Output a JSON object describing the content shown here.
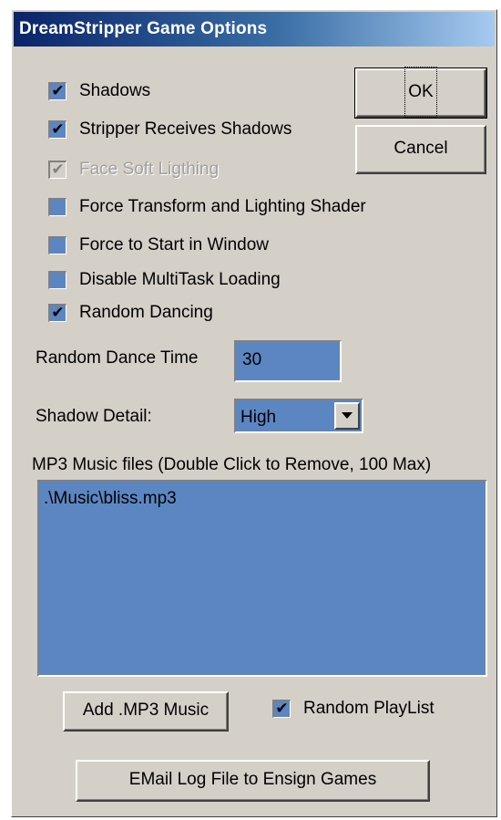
{
  "window": {
    "title": "DreamStripper Game Options"
  },
  "buttons": {
    "ok": "OK",
    "cancel": "Cancel",
    "add_music": "Add .MP3 Music",
    "email_log": "EMail Log File to Ensign Games"
  },
  "checkboxes": [
    {
      "label": "Shadows",
      "checked": true,
      "enabled": true
    },
    {
      "label": "Stripper Receives Shadows",
      "checked": true,
      "enabled": true
    },
    {
      "label": "Face Soft Ligthing",
      "checked": true,
      "enabled": false
    },
    {
      "label": "Force Transform and Lighting Shader",
      "checked": false,
      "enabled": true
    },
    {
      "label": "Force to Start in Window",
      "checked": false,
      "enabled": true
    },
    {
      "label": "Disable MultiTask Loading",
      "checked": false,
      "enabled": true
    },
    {
      "label": "Random Dancing",
      "checked": true,
      "enabled": true
    }
  ],
  "random_dance_time": {
    "label": "Random Dance Time",
    "value": "30"
  },
  "shadow_detail": {
    "label": "Shadow Detail:",
    "selected": "High"
  },
  "music": {
    "label": "MP3 Music files (Double Click to Remove, 100 Max)",
    "files": [
      ".\\Music\\bliss.mp3"
    ]
  },
  "random_playlist": {
    "label": "Random PlayList",
    "checked": true
  },
  "icons": {
    "checkmark": "✔",
    "dropdown": "chevron-down-icon"
  },
  "colors": {
    "dialog_bg": "#d4d0c8",
    "field_bg": "#5b86c2",
    "title_start": "#0a246a",
    "title_end": "#a6caf0"
  }
}
